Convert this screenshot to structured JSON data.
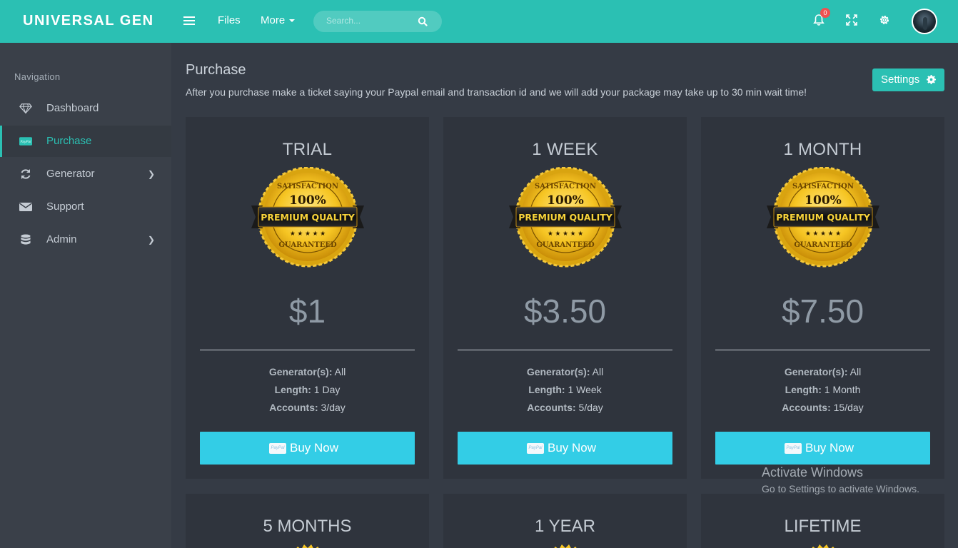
{
  "app": {
    "brand": "UNIVERSAL GEN"
  },
  "topnav": {
    "files_label": "Files",
    "more_label": "More",
    "search_placeholder": "Search...",
    "notification_count": "0"
  },
  "sidebar": {
    "heading": "Navigation",
    "items": [
      {
        "label": "Dashboard",
        "icon": "diamond-icon"
      },
      {
        "label": "Purchase",
        "icon": "paypal-icon",
        "active": true
      },
      {
        "label": "Generator",
        "icon": "refresh-icon",
        "has_submenu": true
      },
      {
        "label": "Support",
        "icon": "envelope-icon"
      },
      {
        "label": "Admin",
        "icon": "database-icon",
        "has_submenu": true
      }
    ]
  },
  "page": {
    "title": "Purchase",
    "description": "After you purchase make a ticket saying your Paypal email and transaction id and we will add your package may take up to 30 min wait time!",
    "settings_label": "Settings"
  },
  "seal": {
    "top_text": "SATISFACTION",
    "percent": "100%",
    "band": "PREMIUM QUALITY",
    "bottom_text": "GUARANTEED"
  },
  "feature_labels": {
    "generators": "Generator(s):",
    "length": "Length:",
    "accounts": "Accounts:"
  },
  "plans": [
    {
      "name": "TRIAL",
      "price": "$1",
      "generators": " All",
      "length": " 1 Day",
      "accounts": " 3/day",
      "button": "Buy Now"
    },
    {
      "name": "1 WEEK",
      "price": "$3.50",
      "generators": " All",
      "length": " 1 Week",
      "accounts": " 5/day",
      "button": "Buy Now"
    },
    {
      "name": "1 MONTH",
      "price": "$7.50",
      "generators": " All",
      "length": " 1 Month",
      "accounts": " 15/day",
      "button": "Buy Now"
    }
  ],
  "more_plans": [
    {
      "name": "5 MONTHS"
    },
    {
      "name": "1 YEAR"
    },
    {
      "name": "LIFETIME"
    }
  ],
  "paypal_mark": "PayPal",
  "windows_watermark": {
    "title": "Activate Windows",
    "subtitle": "Go to Settings to activate Windows."
  },
  "colors": {
    "accent": "#2bc0b3",
    "buy_button": "#33cde6",
    "background": "#353b45",
    "sidebar": "#3a4049",
    "card": "#2f343d"
  }
}
